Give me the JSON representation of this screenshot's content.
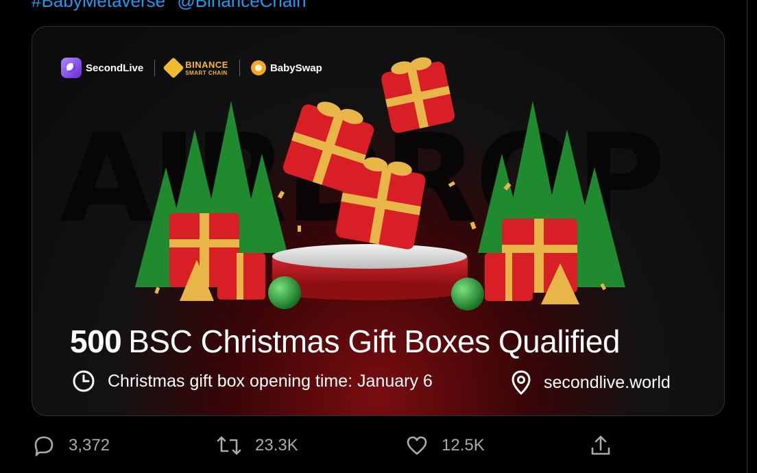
{
  "tweet": {
    "hashtags": [
      "#BabyMetaverse",
      "@BinanceChain"
    ]
  },
  "card": {
    "partners": {
      "secondlive": "SecondLive",
      "binance_main": "BINANCE",
      "binance_sub": "SMART CHAIN",
      "babyswap": "BabySwap"
    },
    "background_word": "AIRDROP",
    "headline_number": "500",
    "headline_text": "BSC Christmas Gift Boxes Qualified",
    "opening_time": "Christmas gift box opening time: January 6",
    "website": "secondlive.world",
    "colors": {
      "gift_red": "#d91f26",
      "ribbon_gold": "#e8b548",
      "tree_green": "#1f8a2e",
      "binance_yellow": "#f3ba2f"
    }
  },
  "actions": {
    "replies": "3,372",
    "retweets": "23.3K",
    "likes": "12.5K"
  },
  "icons": [
    "clock-icon",
    "location-pin-icon",
    "reply-icon",
    "retweet-icon",
    "like-icon",
    "share-icon"
  ]
}
